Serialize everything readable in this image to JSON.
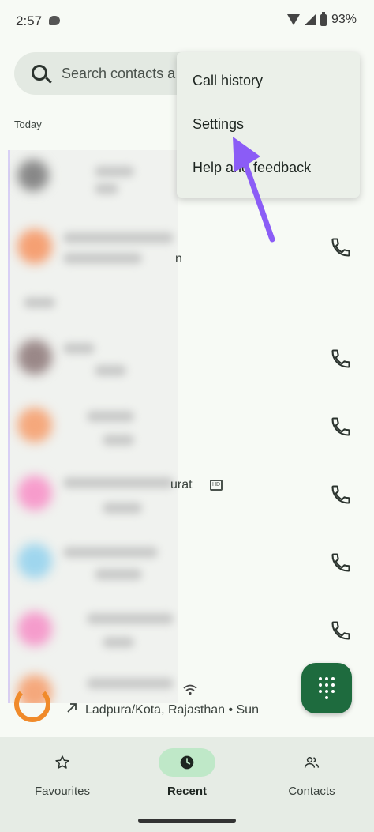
{
  "status_bar": {
    "time": "2:57",
    "battery": "93%"
  },
  "search": {
    "placeholder": "Search contacts a"
  },
  "section": {
    "label": "Today"
  },
  "rows": {
    "partial_name_1": "n",
    "partial_name_2": "urat",
    "hd_badge": "HD",
    "last_meta": "Ladpura/Kota, Rajasthan • Sun"
  },
  "menu": {
    "items": [
      "Call history",
      "Settings",
      "Help and feedback"
    ]
  },
  "bottom_nav": {
    "items": [
      {
        "label": "Favourites",
        "icon": "star-icon"
      },
      {
        "label": "Recent",
        "icon": "clock-icon",
        "active": true
      },
      {
        "label": "Contacts",
        "icon": "people-icon"
      }
    ]
  },
  "colors": {
    "accent": "#1e6b3e",
    "pointer": "#8b5cf6",
    "nav_active": "#bfe8c8"
  }
}
